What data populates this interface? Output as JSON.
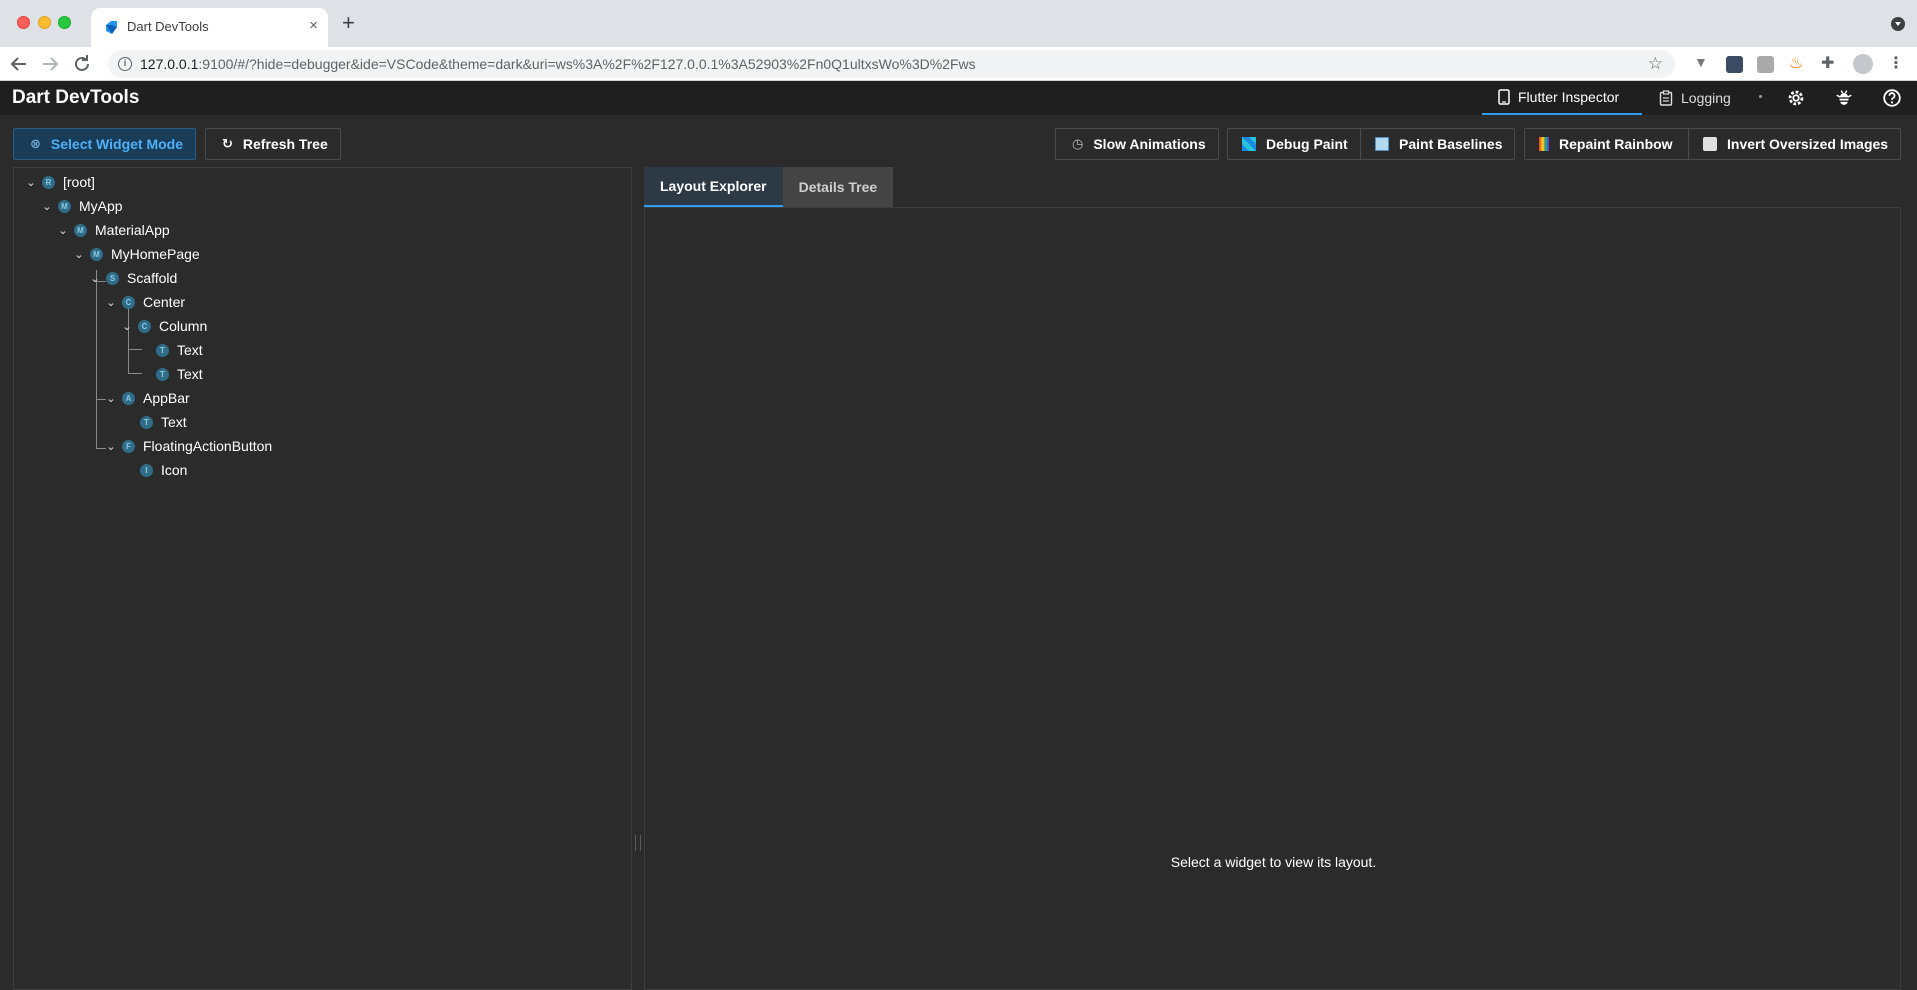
{
  "browser": {
    "tab_title": "Dart DevTools",
    "tab_close": "×",
    "new_tab": "+",
    "url_host": "127.0.0.1",
    "url_rest": ":9100/#/?hide=debugger&ide=VSCode&theme=dark&uri=ws%3A%2F%2F127.0.0.1%3A52903%2Fn0Q1ultxsWo%3D%2Fws"
  },
  "header": {
    "title": "Dart DevTools",
    "tabs": [
      {
        "label": "Flutter Inspector",
        "icon": "phone-icon",
        "active": true
      },
      {
        "label": "Logging",
        "icon": "clipboard-icon",
        "active": false
      }
    ]
  },
  "controls": {
    "select_widget_mode": "Select Widget Mode",
    "refresh_tree": "Refresh Tree",
    "slow_animations": "Slow Animations",
    "debug_paint": "Debug Paint",
    "paint_baselines": "Paint Baselines",
    "repaint_rainbow": "Repaint Rainbow",
    "invert_oversized_images": "Invert Oversized Images"
  },
  "tree": {
    "nodes": [
      {
        "label": "[root]",
        "badge": "R",
        "depth": 0,
        "expandable": true
      },
      {
        "label": "MyApp",
        "badge": "M",
        "depth": 1,
        "expandable": true
      },
      {
        "label": "MaterialApp",
        "badge": "M",
        "depth": 2,
        "expandable": true
      },
      {
        "label": "MyHomePage",
        "badge": "M",
        "depth": 3,
        "expandable": true
      },
      {
        "label": "Scaffold",
        "badge": "S",
        "depth": 4,
        "expandable": true
      },
      {
        "label": "Center",
        "badge": "C",
        "depth": 5,
        "expandable": true
      },
      {
        "label": "Column",
        "badge": "C",
        "depth": 6,
        "expandable": true
      },
      {
        "label": "Text",
        "badge": "T",
        "depth": 7,
        "expandable": false
      },
      {
        "label": "Text",
        "badge": "T",
        "depth": 7,
        "expandable": false
      },
      {
        "label": "AppBar",
        "badge": "A",
        "depth": 5,
        "expandable": true
      },
      {
        "label": "Text",
        "badge": "T",
        "depth": 6,
        "expandable": false
      },
      {
        "label": "FloatingActionButton",
        "badge": "F",
        "depth": 5,
        "expandable": true
      },
      {
        "label": "Icon",
        "badge": "I",
        "depth": 6,
        "expandable": false
      }
    ]
  },
  "details": {
    "tabs": [
      {
        "label": "Layout Explorer",
        "active": true
      },
      {
        "label": "Details Tree",
        "active": false
      }
    ],
    "empty_message": "Select a widget to view its layout."
  },
  "colors": {
    "accent": "#2e9df7",
    "background": "#2b2b2b",
    "header": "#1f1f1f",
    "badge": "#2f6d88"
  }
}
